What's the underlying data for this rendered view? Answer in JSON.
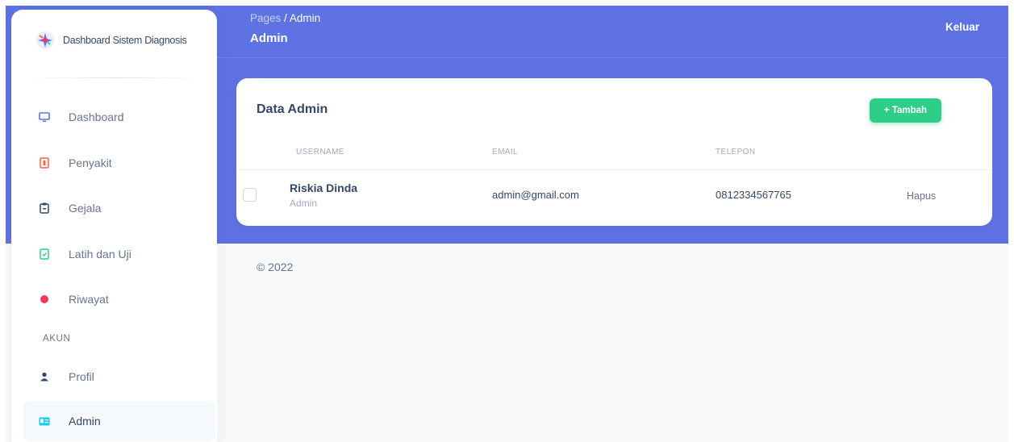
{
  "sidebar": {
    "brand": "Dashboard Sistem Diagnosis",
    "items": [
      {
        "label": "Dashboard",
        "icon": "monitor-icon"
      },
      {
        "label": "Penyakit",
        "icon": "battery-icon"
      },
      {
        "label": "Gejala",
        "icon": "clipboard-icon"
      },
      {
        "label": "Latih dan Uji",
        "icon": "document-icon"
      },
      {
        "label": "Riwayat",
        "icon": "circle-icon"
      }
    ],
    "section_title": "AKUN",
    "account_items": [
      {
        "label": "Profil",
        "icon": "user-icon"
      },
      {
        "label": "Admin",
        "icon": "id-card-icon",
        "active": true
      }
    ]
  },
  "header": {
    "breadcrumb_parent": "Pages",
    "breadcrumb_separator": "/",
    "breadcrumb_current": "Admin",
    "title": "Admin",
    "logout_label": "Keluar"
  },
  "card": {
    "title": "Data Admin",
    "add_label": "+ Tambah",
    "columns": [
      "USERNAME",
      "EMAIL",
      "TELEPON"
    ],
    "rows": [
      {
        "name": "Riskia Dinda",
        "role": "Admin",
        "email": "admin@gmail.com",
        "phone": "0812334567765",
        "action": "Hapus"
      }
    ]
  },
  "footer": {
    "text": "© 2022"
  },
  "colors": {
    "primary": "#5e72e4",
    "success": "#2dce89",
    "text_dark": "#344767",
    "text_muted": "#67748e",
    "background": "#f8f9fa"
  }
}
